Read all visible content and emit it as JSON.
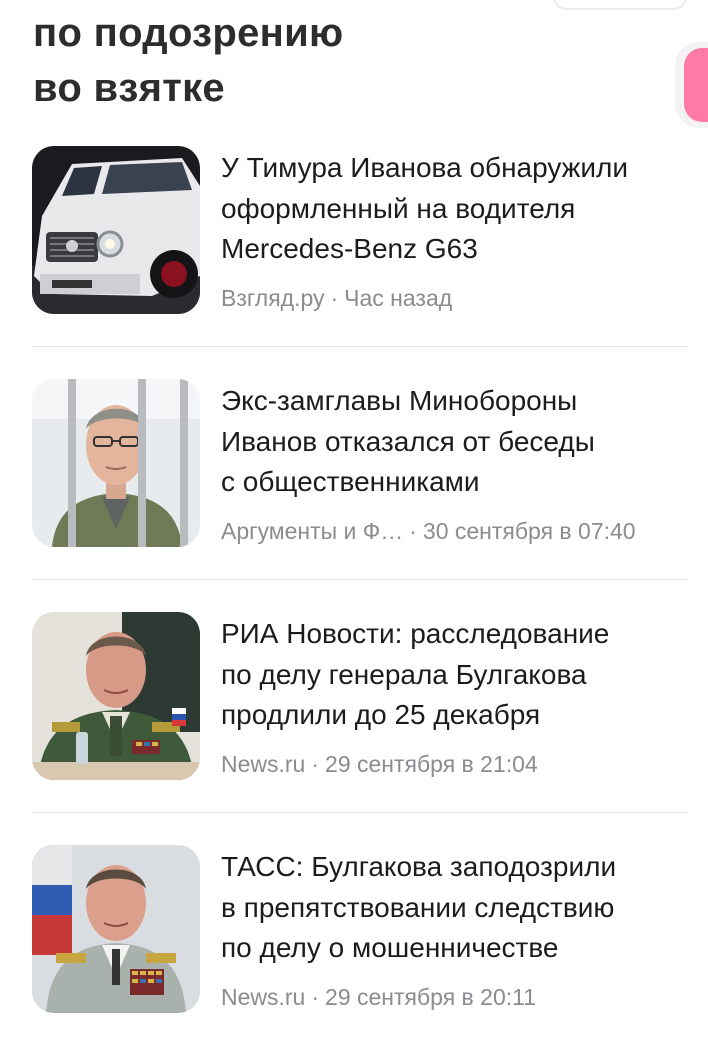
{
  "header": {
    "line1": "по подозрению",
    "line2": "во взятке"
  },
  "news": [
    {
      "title_lines": [
        "У Тимура Иванова обнаружили",
        "оформленный на водителя",
        "Mercedes-Benz G63"
      ],
      "source": "Взгляд.ру",
      "separator": "·",
      "time": "Час назад",
      "thumb_icon": "white-suv-photo"
    },
    {
      "title_lines": [
        "Экс-замглавы Минобороны",
        "Иванов отказался от беседы",
        "с общественниками"
      ],
      "source": "Аргументы и Ф…",
      "separator": "·",
      "time": "30 сентября в 07:40",
      "thumb_icon": "man-behind-bars-photo"
    },
    {
      "title_lines": [
        "РИА Новости: расследование",
        "по делу генерала Булгакова",
        "продлили до 25 декабря"
      ],
      "source": "News.ru",
      "separator": "·",
      "time": "29 сентября в 21:04",
      "thumb_icon": "general-at-desk-photo"
    },
    {
      "title_lines": [
        "ТАСС: Булгакова заподозрили",
        "в препятствовании следствию",
        "по делу о мошенничестве"
      ],
      "source": "News.ru",
      "separator": "·",
      "time": "29 сентября в 20:11",
      "thumb_icon": "general-portrait-photo"
    }
  ],
  "colors": {
    "accent_pink": "#ff7aa6",
    "meta_gray": "#8b8b90",
    "divider": "#e3e3e6"
  }
}
